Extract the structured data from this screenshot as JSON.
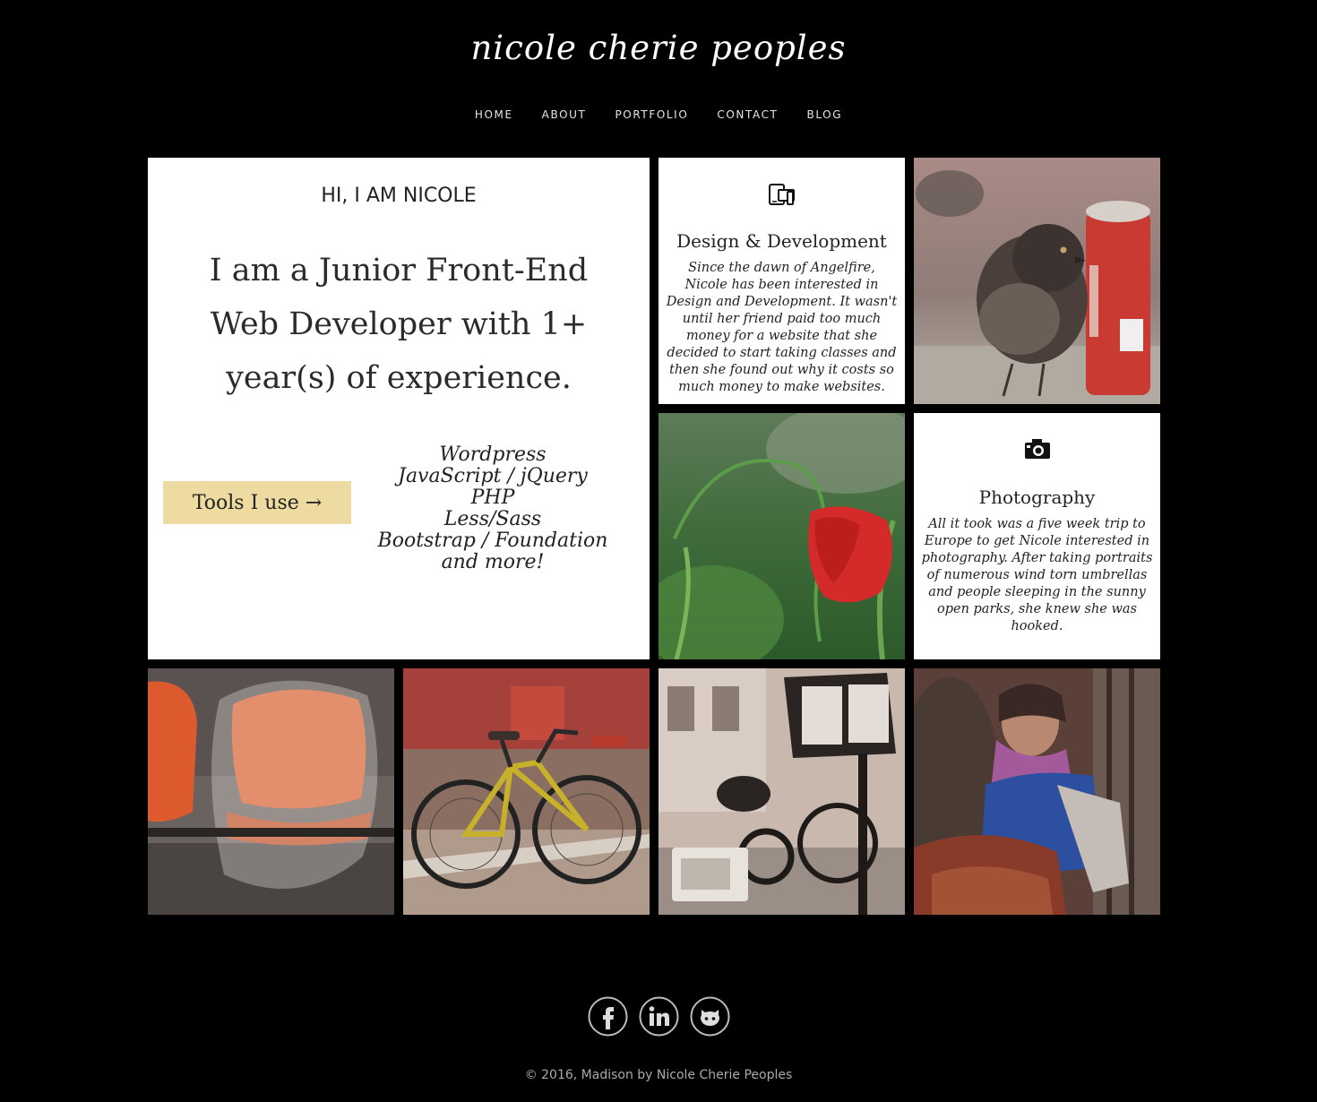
{
  "site": {
    "title": "nicole cherie peoples"
  },
  "nav": {
    "items": [
      {
        "label": "HOME"
      },
      {
        "label": "ABOUT"
      },
      {
        "label": "PORTFOLIO"
      },
      {
        "label": "CONTACT"
      },
      {
        "label": "BLOG"
      }
    ]
  },
  "intro": {
    "heading": "HI, I AM NICOLE",
    "tagline": "I am a Junior Front-End Web Developer with 1+ year(s) of experience.",
    "tools_button": "Tools I use →",
    "tools_button_color": "#eddba1",
    "tools": [
      "Wordpress",
      "JavaScript / jQuery",
      "PHP",
      "Less/Sass",
      "Bootstrap / Foundation",
      "and more!"
    ]
  },
  "services": [
    {
      "icon": "devices-icon",
      "title": "Design & Development",
      "description": "Since the dawn of Angelfire, Nicole has been interested in Design and Development. It wasn't until her friend paid too much money for a website that she decided to start taking classes and then she found out why it costs so much money to make websites."
    },
    {
      "icon": "camera-icon",
      "title": "Photography",
      "description": "All it took was a five week trip to Europe to get Nicole interested in photography. After taking portraits of numerous wind torn umbrellas and people sleeping in the sunny open parks, she knew she was hooked."
    }
  ],
  "photos": [
    {
      "subject": "pigeon-and-soda-can-photo"
    },
    {
      "subject": "red-poppy-photo"
    },
    {
      "subject": "orange-chairs-photo"
    },
    {
      "subject": "bicycle-photo"
    },
    {
      "subject": "street-sign-and-scooter-photo"
    },
    {
      "subject": "woman-with-scarf-photo"
    }
  ],
  "social": [
    {
      "icon": "facebook-icon"
    },
    {
      "icon": "linkedin-icon"
    },
    {
      "icon": "github-icon"
    }
  ],
  "footer": {
    "text": "© 2016, Madison by Nicole Cherie Peoples"
  },
  "colors": {
    "background": "#000000",
    "tile": "#ffffff",
    "accent": "#eddba1"
  }
}
